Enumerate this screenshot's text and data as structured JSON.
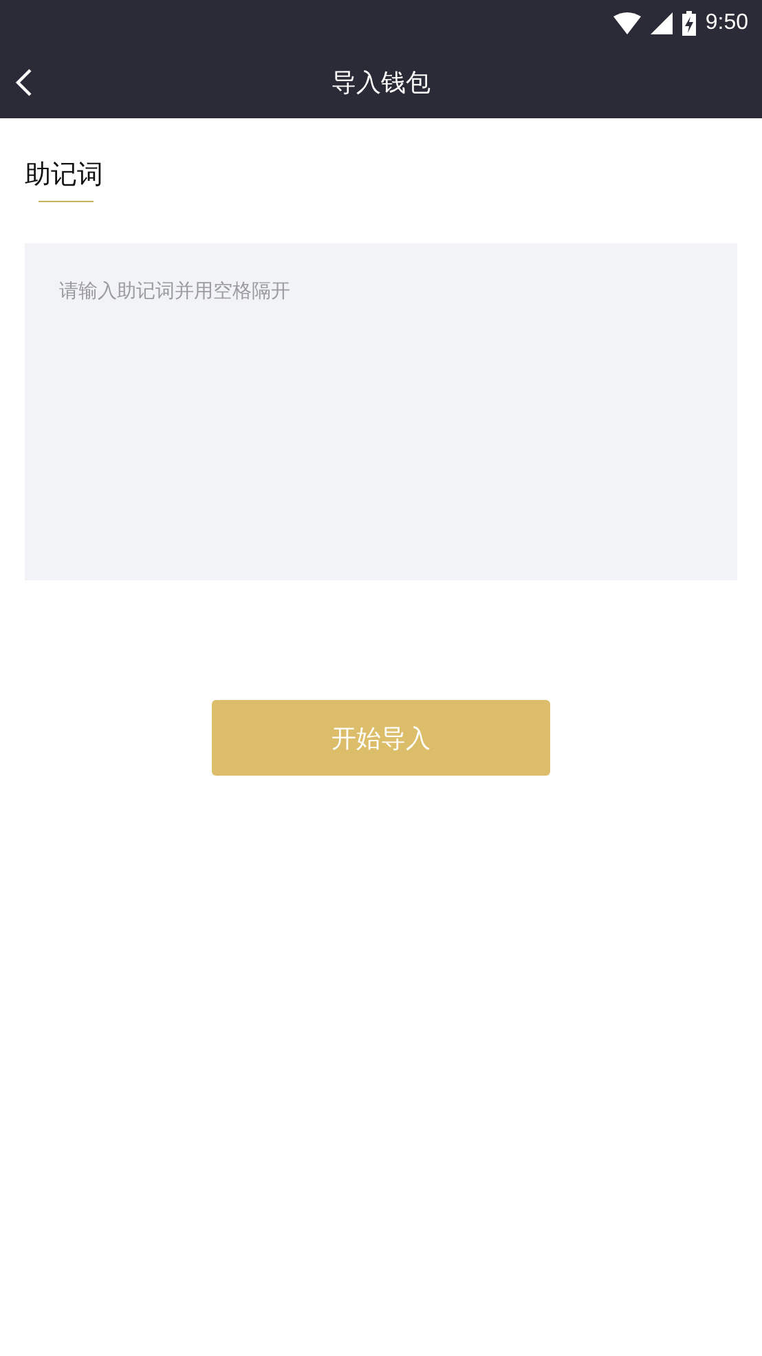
{
  "status_bar": {
    "time": "9:50"
  },
  "header": {
    "title": "导入钱包"
  },
  "section": {
    "title": "助记词"
  },
  "mnemonic_field": {
    "placeholder": "请输入助记词并用空格隔开"
  },
  "submit_button": {
    "label": "开始导入"
  }
}
